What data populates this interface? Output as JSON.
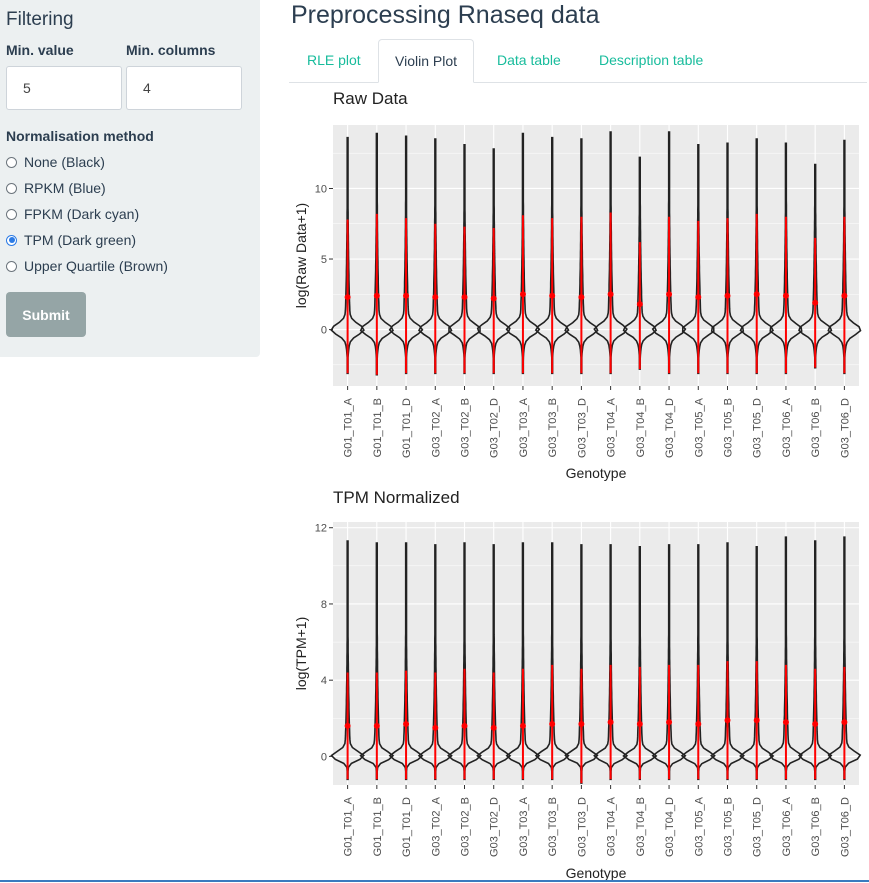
{
  "sidebar": {
    "title": "Filtering",
    "min_value": {
      "label": "Min. value",
      "value": "5"
    },
    "min_columns": {
      "label": "Min. columns",
      "value": "4"
    },
    "normalisation": {
      "label": "Normalisation method",
      "options": [
        "None (Black)",
        "RPKM (Blue)",
        "FPKM (Dark cyan)",
        "TPM (Dark green)",
        "Upper Quartile (Brown)"
      ],
      "selected": "TPM (Dark green)"
    },
    "submit_label": "Submit"
  },
  "main": {
    "title": "Preprocessing Rnaseq data",
    "tabs": [
      {
        "label": "RLE plot",
        "active": false
      },
      {
        "label": "Violin Plot",
        "active": true
      },
      {
        "label": "Data table",
        "active": false
      },
      {
        "label": "Description table",
        "active": false
      }
    ]
  },
  "colors": {
    "accent": "#18bc9c",
    "panel": "#ebebeb",
    "violin": "#222222",
    "summary": "#ff0000",
    "sidebar_bg": "#ecf0f1",
    "button": "#95a5a6"
  },
  "chart_data": [
    {
      "type": "violin",
      "title": "Raw Data",
      "xlabel": "Genotype",
      "ylabel": "log(Raw Data+1)",
      "ylim": [
        -4,
        14.5
      ],
      "yticks": [
        0,
        5,
        10
      ],
      "grid": true,
      "categories": [
        "G01_T01_A",
        "G01_T01_B",
        "G01_T01_D",
        "G03_T02_A",
        "G03_T02_B",
        "G03_T02_D",
        "G03_T03_A",
        "G03_T03_B",
        "G03_T03_D",
        "G03_T04_A",
        "G03_T04_B",
        "G03_T04_D",
        "G03_T05_A",
        "G03_T05_B",
        "G03_T05_D",
        "G03_T06_A",
        "G03_T06_B",
        "G03_T06_D"
      ],
      "max": [
        13.6,
        13.9,
        13.7,
        13.5,
        13.1,
        12.8,
        13.9,
        13.6,
        13.5,
        14.0,
        12.2,
        14.0,
        13.1,
        13.2,
        13.5,
        13.2,
        11.7,
        13.4
      ],
      "mean": [
        2.3,
        2.4,
        2.4,
        2.3,
        2.3,
        2.2,
        2.5,
        2.4,
        2.3,
        2.5,
        1.8,
        2.5,
        2.3,
        2.4,
        2.5,
        2.4,
        1.9,
        2.4
      ],
      "upper": [
        7.8,
        8.2,
        7.9,
        7.5,
        7.3,
        7.2,
        8.1,
        7.9,
        8.0,
        8.3,
        6.2,
        8.0,
        7.7,
        7.9,
        8.2,
        8.0,
        6.5,
        8.0
      ],
      "lower": [
        -3.1,
        -3.2,
        -3.1,
        -3.1,
        -3.1,
        -3.1,
        -3.1,
        -3.1,
        -3.1,
        -3.1,
        -2.8,
        -3.1,
        -3.1,
        -3.1,
        -3.1,
        -3.1,
        -2.7,
        -3.1
      ]
    },
    {
      "type": "violin",
      "title": "TPM Normalized",
      "xlabel": "Genotype",
      "ylabel": "log(TPM+1)",
      "ylim": [
        -1.5,
        12.3
      ],
      "yticks": [
        0,
        4,
        8,
        12
      ],
      "grid": true,
      "categories": [
        "G01_T01_A",
        "G01_T01_B",
        "G01_T01_D",
        "G03_T02_A",
        "G03_T02_B",
        "G03_T02_D",
        "G03_T03_A",
        "G03_T03_B",
        "G03_T03_D",
        "G03_T04_A",
        "G03_T04_B",
        "G03_T04_D",
        "G03_T05_A",
        "G03_T05_B",
        "G03_T05_D",
        "G03_T06_A",
        "G03_T06_B",
        "G03_T06_D"
      ],
      "max": [
        11.3,
        11.2,
        11.2,
        11.1,
        11.2,
        11.1,
        11.2,
        11.2,
        11.1,
        11.1,
        11.0,
        11.1,
        11.1,
        11.2,
        11.0,
        11.5,
        11.3,
        11.5
      ],
      "mean": [
        1.6,
        1.6,
        1.7,
        1.5,
        1.6,
        1.5,
        1.6,
        1.7,
        1.7,
        1.8,
        1.7,
        1.8,
        1.7,
        1.9,
        1.9,
        1.8,
        1.7,
        1.8
      ],
      "upper": [
        4.4,
        4.4,
        4.5,
        4.4,
        4.6,
        4.4,
        4.6,
        4.8,
        4.6,
        4.8,
        4.7,
        4.8,
        4.8,
        5.0,
        5.0,
        4.8,
        4.6,
        4.7
      ],
      "lower": [
        -1.2,
        -1.2,
        -1.2,
        -1.2,
        -1.2,
        -1.2,
        -1.2,
        -1.2,
        -1.4,
        -1.2,
        -1.2,
        -1.2,
        -1.2,
        -1.2,
        -1.2,
        -1.2,
        -1.2,
        -1.2
      ]
    }
  ]
}
